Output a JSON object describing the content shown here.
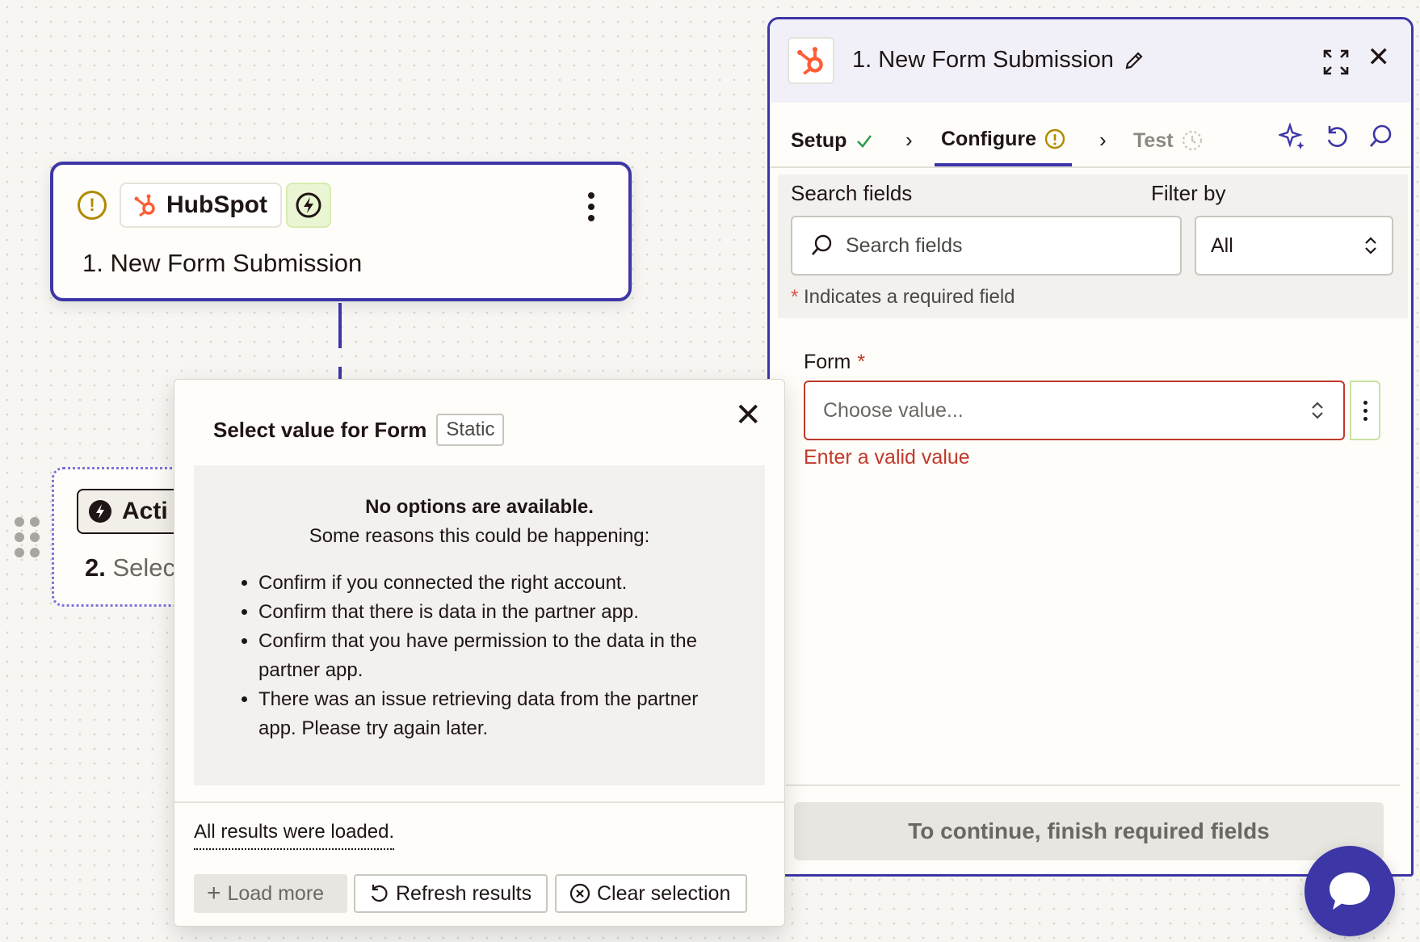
{
  "trigger_card": {
    "app_name": "HubSpot",
    "title": "1. New Form Submission"
  },
  "action_card": {
    "chip_label": "Acti",
    "title_number": "2.",
    "title_text": "Selec"
  },
  "popover": {
    "title": "Select value for Form",
    "badge": "Static",
    "heading": "No options are available.",
    "subheading": "Some reasons this could be happening:",
    "reasons": [
      "Confirm if you connected the right account.",
      "Confirm that there is data in the partner app.",
      "Confirm that you have permission to the data in the partner app.",
      "There was an issue retrieving data from the partner app. Please try again later."
    ],
    "loaded_text": "All results were loaded.",
    "load_more_label": "Load more",
    "refresh_label": "Refresh results",
    "clear_label": "Clear selection"
  },
  "panel": {
    "title": "1. New Form Submission",
    "tabs": {
      "setup": "Setup",
      "configure": "Configure",
      "test": "Test"
    },
    "search_label": "Search fields",
    "search_placeholder": "Search fields",
    "filter_label": "Filter by",
    "filter_value": "All",
    "required_note": "Indicates a required field",
    "required_star": "*",
    "form_label": "Form",
    "form_placeholder": "Choose value...",
    "form_error": "Enter a valid value",
    "continue_label": "To continue, finish required fields"
  },
  "colors": {
    "accent": "#3d36a6",
    "hubspot": "#ff5c35",
    "error": "#c0392b",
    "warning": "#b08a00",
    "success": "#2e9e4f"
  },
  "icons": [
    "warning-icon",
    "hubspot-icon",
    "bolt-icon",
    "more-icon",
    "close-icon",
    "pencil-icon",
    "expand-icon",
    "check-icon",
    "chevron-right-icon",
    "loading-icon",
    "sparkle-icon",
    "undo-icon",
    "search-icon",
    "updown-icon",
    "plus-icon",
    "refresh-icon",
    "clear-icon",
    "chat-icon",
    "drag-handle-icon"
  ]
}
